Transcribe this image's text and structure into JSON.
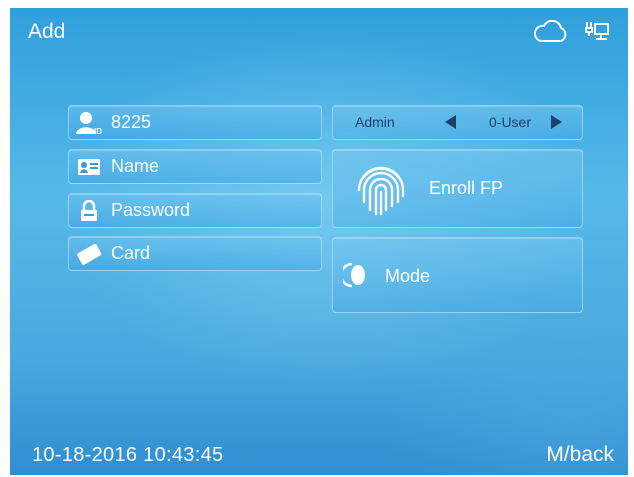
{
  "header": {
    "title": "Add",
    "icons": [
      "cloud-icon",
      "network-icon"
    ]
  },
  "form": {
    "user_id": {
      "icon": "user-id-icon",
      "value": "8225"
    },
    "name": {
      "icon": "name-card-icon",
      "label": "Name"
    },
    "password": {
      "icon": "lock-icon",
      "label": "Password"
    },
    "card": {
      "icon": "card-icon",
      "label": "Card"
    }
  },
  "role": {
    "label": "Admin",
    "value": "0-User"
  },
  "enroll_fp": {
    "icon": "fingerprint-icon",
    "label": "Enroll FP"
  },
  "mode": {
    "icon": "mode-icon",
    "label": "Mode"
  },
  "footer": {
    "datetime": "10-18-2016 10:43:45",
    "back_label": "M/back"
  },
  "colors": {
    "background": "#4aa8de",
    "accent_text": "#1d3f6a"
  }
}
